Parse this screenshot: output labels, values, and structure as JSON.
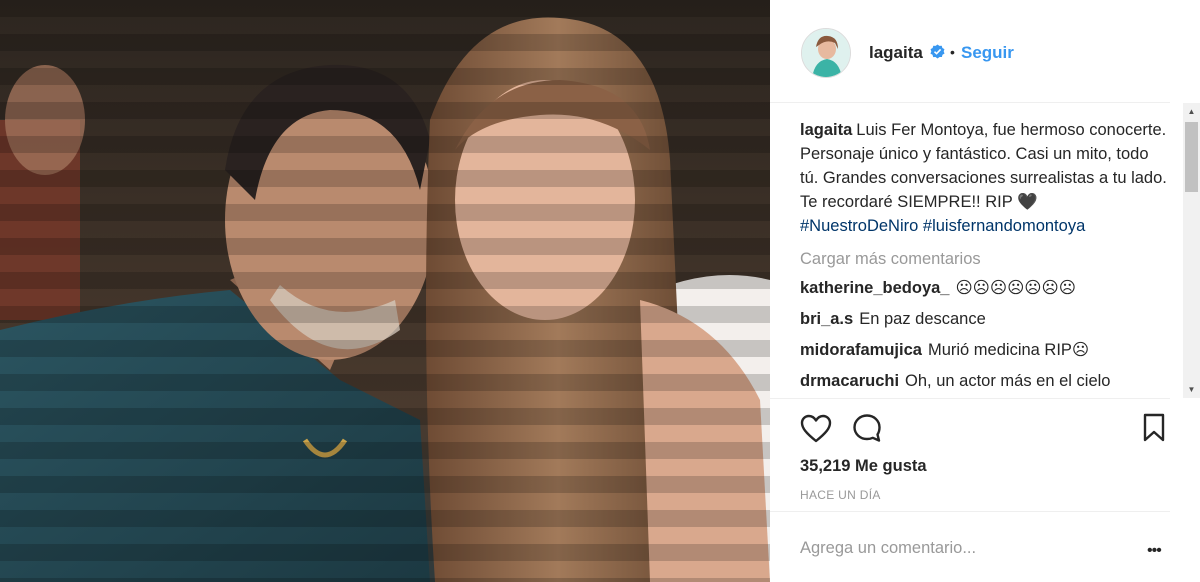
{
  "post": {
    "username": "lagaita",
    "verified": true,
    "separator": "•",
    "follow_label": "Seguir",
    "caption_user": "lagaita",
    "caption_text": "Luis Fer Montoya, fue hermoso conocerte. Personaje único y fantástico. Casi un mito, todo tú. Grandes conversaciones surrealistas a tu lado. Te recordaré SIEMPRE!! RIP 🖤",
    "hashtags": [
      "#NuestroDeNiro",
      "#luisfernandomontoya"
    ],
    "load_more_label": "Cargar más comentarios",
    "comments": [
      {
        "user": "katherine_bedoya_",
        "text": "☹☹☹☹☹☹☹"
      },
      {
        "user": "bri_a.s",
        "text": "En paz descance"
      },
      {
        "user": "midorafamujica",
        "text": "Murió medicina RIP☹"
      },
      {
        "user": "drmacaruchi",
        "text": "Oh, un actor más en el cielo"
      }
    ],
    "likes_text": "35,219 Me gusta",
    "time_text": "HACE UN DÍA",
    "comment_placeholder": "Agrega un comentario...",
    "more_label": "•••"
  },
  "icons": {
    "like": "heart-icon",
    "comment": "comment-bubble-icon",
    "save": "bookmark-icon",
    "verified": "verified-badge-icon"
  },
  "colors": {
    "link": "#3897f0",
    "hashtag": "#003569",
    "muted": "#999999",
    "text": "#262626"
  }
}
